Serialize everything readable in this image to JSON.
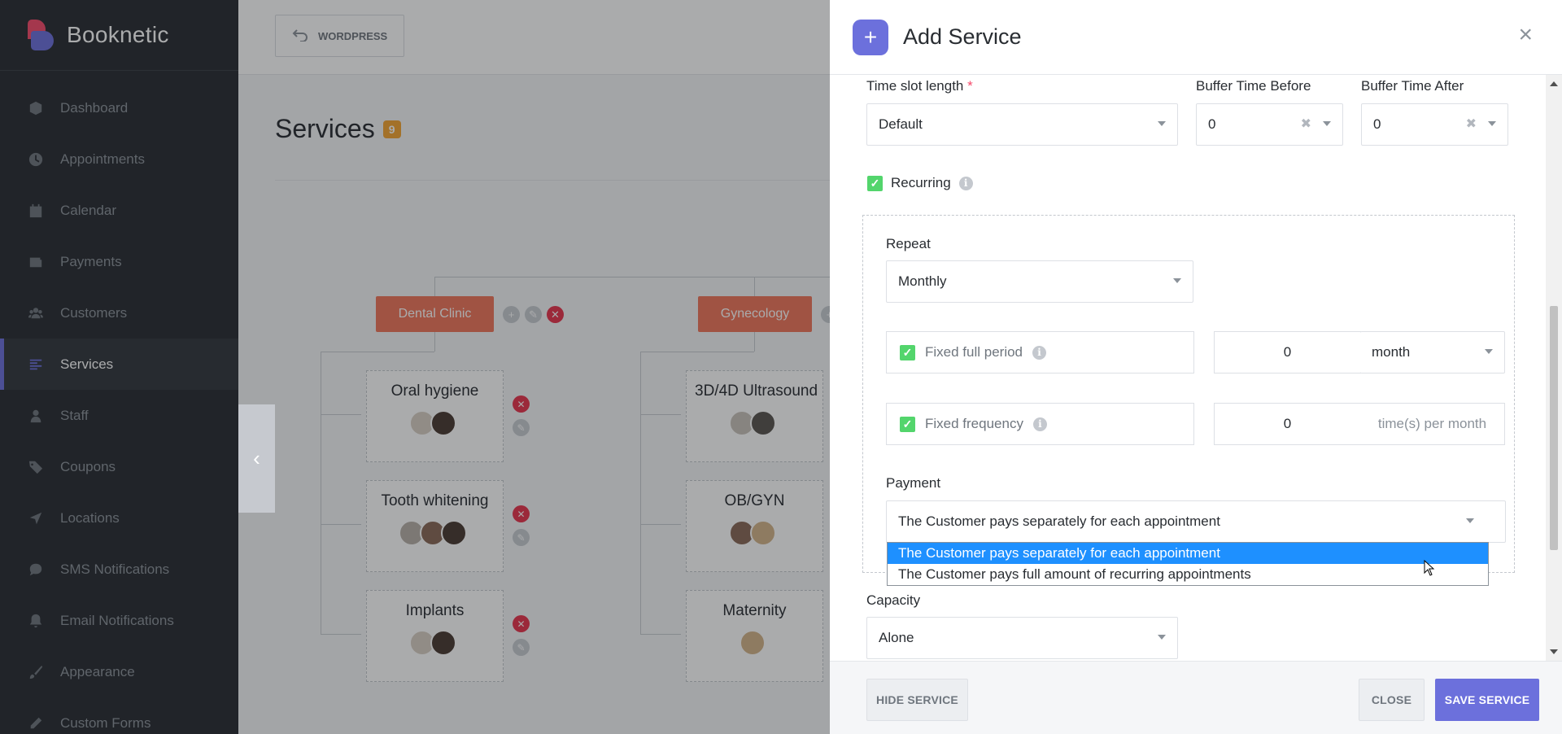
{
  "app": {
    "name": "Booknetic"
  },
  "sidebar": {
    "items": [
      {
        "label": "Dashboard",
        "icon": "cube-icon"
      },
      {
        "label": "Appointments",
        "icon": "clock-icon"
      },
      {
        "label": "Calendar",
        "icon": "calendar-icon"
      },
      {
        "label": "Payments",
        "icon": "wallet-icon"
      },
      {
        "label": "Customers",
        "icon": "users-icon"
      },
      {
        "label": "Services",
        "icon": "list-icon",
        "active": true
      },
      {
        "label": "Staff",
        "icon": "user-icon"
      },
      {
        "label": "Coupons",
        "icon": "tag-icon"
      },
      {
        "label": "Locations",
        "icon": "location-arrow-icon"
      },
      {
        "label": "SMS Notifications",
        "icon": "chat-icon"
      },
      {
        "label": "Email Notifications",
        "icon": "bell-icon"
      },
      {
        "label": "Appearance",
        "icon": "brush-icon"
      },
      {
        "label": "Custom Forms",
        "icon": "pencil-icon"
      }
    ]
  },
  "topbar": {
    "wordpress_label": "WORDPRESS"
  },
  "services_page": {
    "title": "Services",
    "count": "9",
    "categories": [
      {
        "name": "Dental Clinic",
        "services": [
          "Oral hygiene",
          "Tooth whitening",
          "Implants"
        ]
      },
      {
        "name": "Gynecology",
        "services": [
          "3D/4D Ultrasound",
          "OB/GYN",
          "Maternity"
        ]
      }
    ]
  },
  "modal": {
    "title": "Add Service",
    "time_slot": {
      "label": "Time slot length",
      "value": "Default"
    },
    "buffer_before": {
      "label": "Buffer Time Before",
      "value": "0"
    },
    "buffer_after": {
      "label": "Buffer Time After",
      "value": "0"
    },
    "recurring": {
      "label": "Recurring",
      "checked": true
    },
    "repeat": {
      "label": "Repeat",
      "value": "Monthly"
    },
    "fixed_full_period": {
      "label": "Fixed full period",
      "value": "0",
      "unit": "month"
    },
    "fixed_frequency": {
      "label": "Fixed frequency",
      "value": "0",
      "unit": "time(s) per month"
    },
    "payment": {
      "label": "Payment",
      "value": "The Customer pays separately for each appointment",
      "options": [
        "The Customer pays separately for each appointment",
        "The Customer pays full amount of recurring appointments"
      ]
    },
    "capacity": {
      "label": "Capacity",
      "value": "Alone"
    },
    "buttons": {
      "hide": "HIDE SERVICE",
      "close": "CLOSE",
      "save": "SAVE SERVICE"
    }
  },
  "colors": {
    "accent": "#6c70dc",
    "category": "#f0765b",
    "danger": "#e8344e",
    "success": "#53d56c",
    "badge": "#f4a532"
  }
}
